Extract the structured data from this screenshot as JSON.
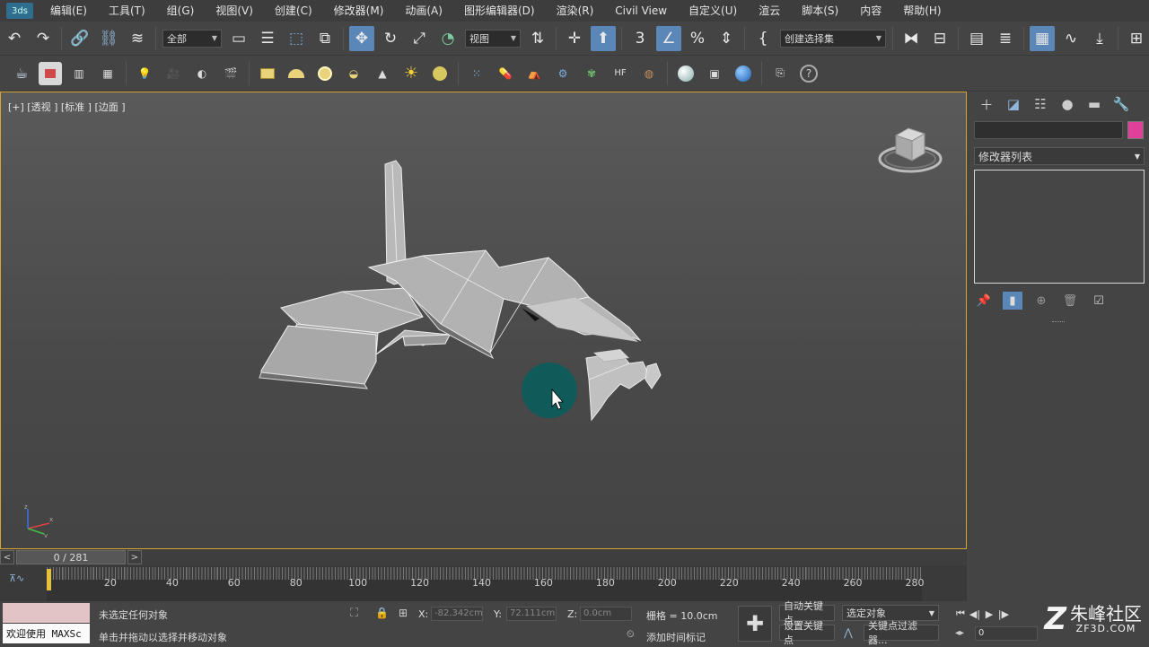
{
  "menu": {
    "logo_text": "3ds",
    "items": [
      "编辑(E)",
      "工具(T)",
      "组(G)",
      "视图(V)",
      "创建(C)",
      "修改器(M)",
      "动画(A)",
      "图形编辑器(D)",
      "渲染(R)",
      "Civil View",
      "自定义(U)",
      "渲云",
      "脚本(S)",
      "内容",
      "帮助(H)"
    ]
  },
  "toolbar1": {
    "selection_filter": "全部",
    "ref_coord": "视图",
    "named_selection": "创建选择集",
    "snap_label": "3"
  },
  "viewport": {
    "label": "[+] [透视 ] [标准 ] [边面 ]",
    "axis_x": "x",
    "axis_y": "y",
    "axis_z": "z"
  },
  "command_panel": {
    "modifier_list": "修改器列表",
    "color": "#e0409a"
  },
  "timeline": {
    "position": "0 / 281",
    "prev": "<",
    "next": ">",
    "current_frame": 0,
    "total_frames": 281,
    "ticks": [
      20,
      40,
      60,
      80,
      100,
      120,
      140,
      160,
      180,
      200,
      220,
      240,
      260,
      280
    ]
  },
  "status": {
    "maxscript_text": "欢迎使用 MAXSc",
    "selection_msg": "未选定任何对象",
    "prompt_msg": "单击并拖动以选择并移动对象",
    "x_label": "X:",
    "x_value": "-82.342cm",
    "y_label": "Y:",
    "y_value": "72.111cm",
    "z_label": "Z:",
    "z_value": "0.0cm",
    "grid": "栅格 = 10.0cm",
    "add_time_tag": "添加时间标记",
    "auto_key": "自动关键点",
    "set_key": "设置关键点",
    "selected_obj": "选定对象",
    "key_filters": "关键点过滤器...",
    "frame_field": "0"
  },
  "watermark": {
    "brand": "朱峰社区",
    "url": "ZF3D.COM",
    "logo": "Z"
  },
  "colors": {
    "active_tool": "#5b86b8",
    "viewport_border": "#d6a53a",
    "cursor_highlight": "#0e5c5c"
  }
}
